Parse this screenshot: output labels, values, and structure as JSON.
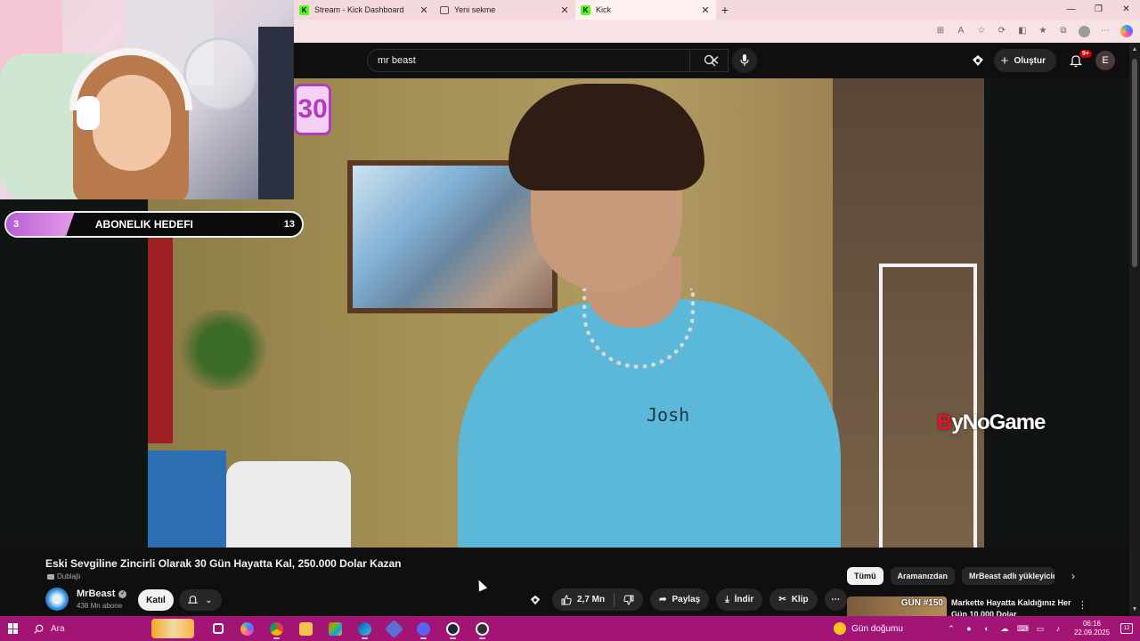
{
  "browser": {
    "tabs": [
      {
        "title": "Stream - Kick Dashboard",
        "icon": "kick-icon",
        "active": false
      },
      {
        "title": "Yeni sekme",
        "icon": "page-icon",
        "active": false
      },
      {
        "title": "Kick",
        "icon": "kick-icon",
        "active": true
      }
    ],
    "new_tab_symbol": "+",
    "window_controls": [
      "—",
      "❐",
      "✕"
    ]
  },
  "youtube": {
    "search": {
      "value": "mr beast"
    },
    "create_label": "Oluştur",
    "notifications_badge": "9+",
    "user_initial": "E"
  },
  "overlay": {
    "sub_goal": {
      "label": "ABONELIK HEDEFI",
      "current": "3",
      "goal": "13",
      "progress_fraction": 0.23
    },
    "video_badge": "30",
    "watermark_prefix": "B",
    "watermark_rest": "yNoGame"
  },
  "video_scene": {
    "shirt_text": "Josh"
  },
  "video": {
    "title": "Eski Sevgiline Zincirli Olarak 30 Gün Hayatta Kal, 250.000 Dolar Kazan",
    "dubbed_label": "Dublajlı",
    "channel": {
      "name": "MrBeast",
      "subs": "438 Mn abone"
    },
    "join_label": "Katıl",
    "likes": "2,7 Mn",
    "share_label": "Paylaş",
    "download_label": "İndir",
    "clip_label": "Klip",
    "more_symbol": "⋯"
  },
  "sidebar": {
    "chips": [
      "Tümü",
      "Aramanızdan",
      "MrBeast adlı yükleyiciden"
    ],
    "recommendation": {
      "thumb_text": "GÜN #150",
      "title": "Markette Hayatta Kaldığınız Her Gün 10.000 Dolar"
    }
  },
  "taskbar": {
    "search_label": "Ara",
    "weather": "Gün doğumu",
    "time": "06:16",
    "date": "22.09.2025",
    "notification_count": "12"
  },
  "colors": {
    "youtube_bg": "#0f0f0f",
    "taskbar": "#a31574",
    "tabstrip": "#f3d9db",
    "kick_green": "#53fc18"
  }
}
